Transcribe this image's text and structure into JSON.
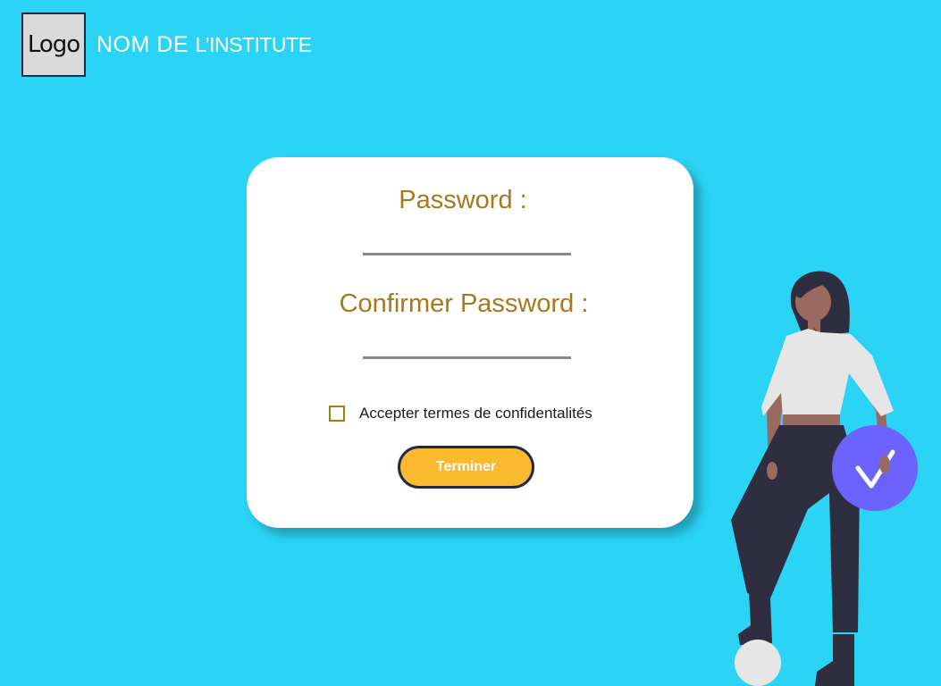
{
  "header": {
    "logo_text": "Logo",
    "institute_prefix": "NOM DE ",
    "institute_suffix": "L’INSTITUTE"
  },
  "form": {
    "password_label": "Password :",
    "password_value": "",
    "confirm_label": "Confirmer Password :",
    "confirm_value": "",
    "terms_label": "Accepter termes de confidentalités",
    "terms_checked": false,
    "submit_label": "Terminer"
  },
  "colors": {
    "background": "#2bd3f4",
    "card": "#ffffff",
    "label": "#a8781c",
    "button": "#fbb92f",
    "button_border": "#1f2a44",
    "check_badge": "#6c63ff"
  },
  "illustration": {
    "subject": "woman-standing-with-checkmark",
    "badge_icon": "checkmark-icon"
  }
}
